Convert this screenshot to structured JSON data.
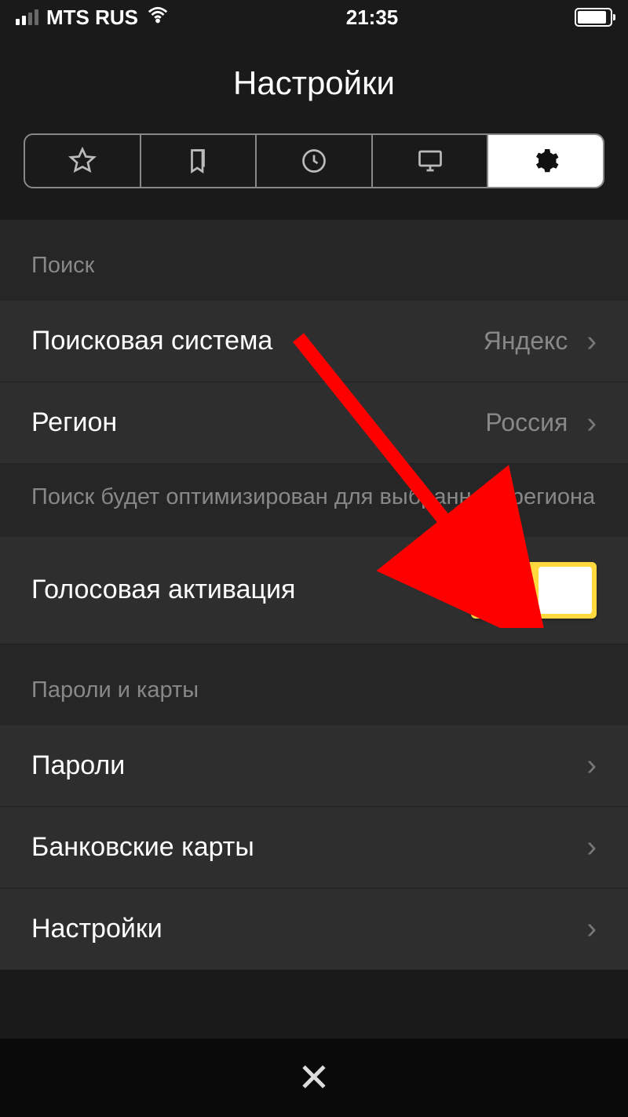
{
  "status_bar": {
    "carrier": "MTS RUS",
    "time": "21:35"
  },
  "header": {
    "title": "Настройки"
  },
  "tabs": {
    "icons": [
      "star",
      "bookmarks",
      "history",
      "desktop",
      "settings"
    ],
    "active_index": 4
  },
  "sections": {
    "search": {
      "header": "Поиск",
      "rows": {
        "engine": {
          "label": "Поисковая система",
          "value": "Яндекс"
        },
        "region": {
          "label": "Регион",
          "value": "Россия"
        },
        "region_note": "Поиск будет оптимизирован для выбранного региона",
        "voice": {
          "label": "Голосовая активация",
          "enabled": true
        }
      }
    },
    "passwords": {
      "header": "Пароли и карты",
      "rows": {
        "passwords": {
          "label": "Пароли"
        },
        "cards": {
          "label": "Банковские карты"
        },
        "settings": {
          "label": "Настройки"
        }
      }
    }
  }
}
